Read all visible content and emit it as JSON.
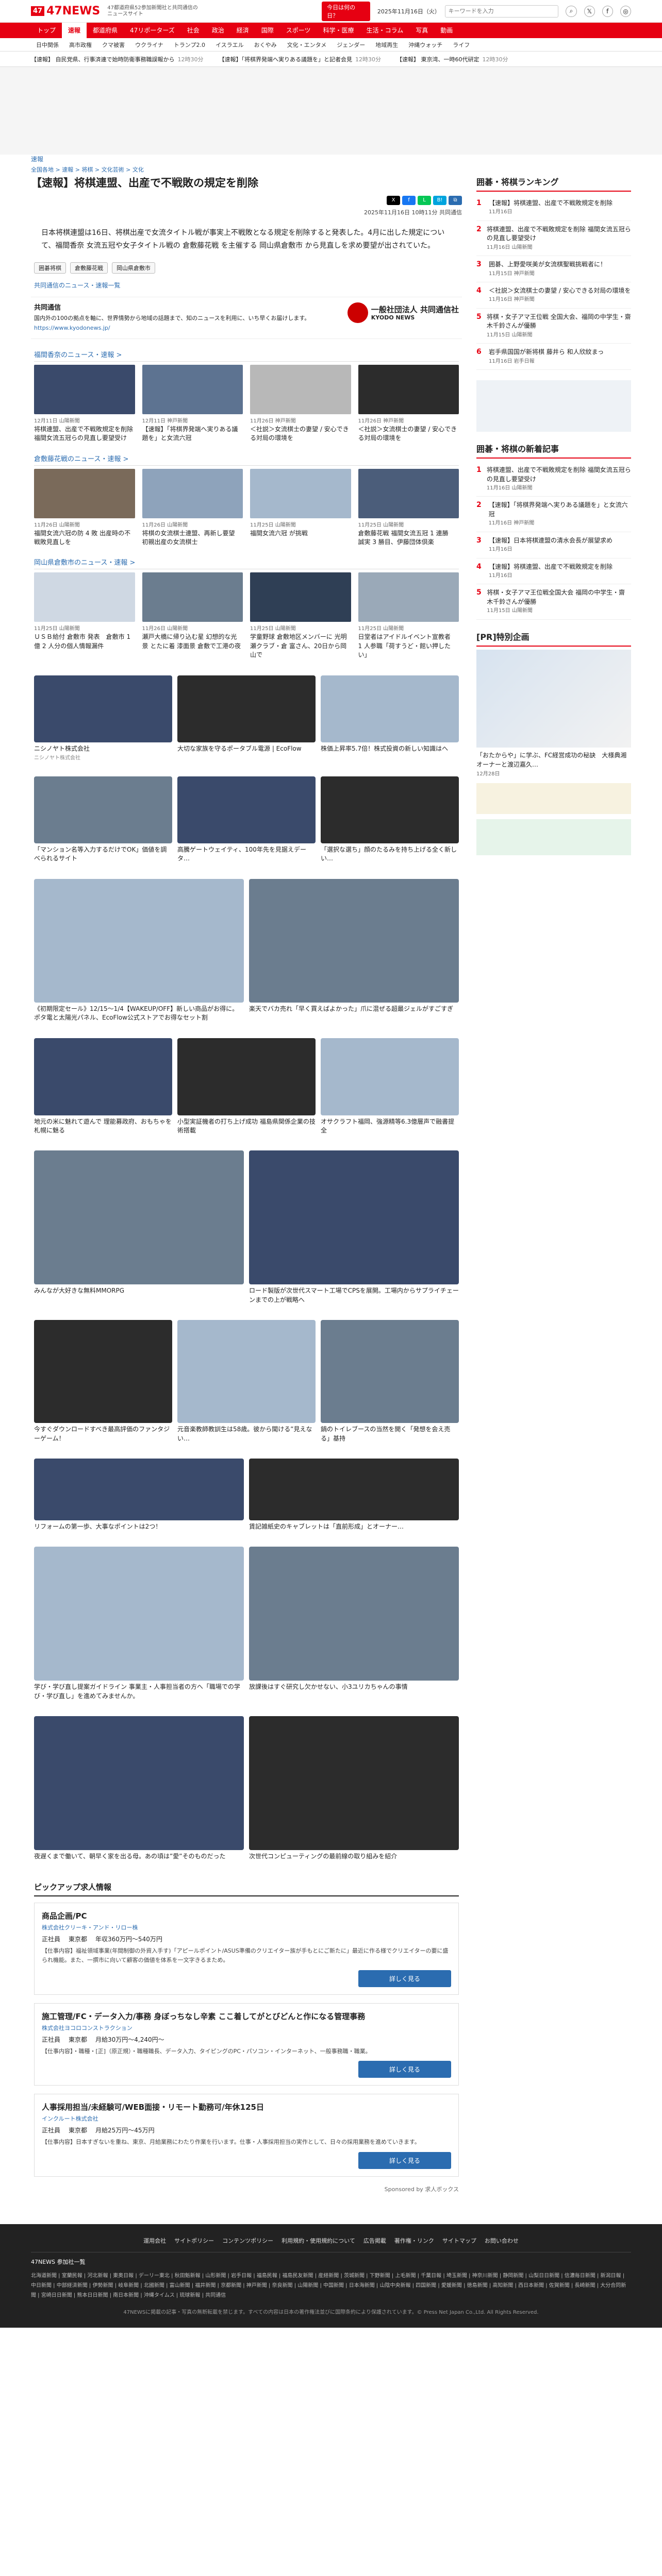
{
  "header": {
    "logo": "47NEWS",
    "logo_mark": "47",
    "tagline": "47都道府県52参加新聞社と共同通信のニュースサイト",
    "today_btn": "今日は何の日？",
    "date": "2025年11月16日（火）",
    "search_placeholder": "キーワードを入力"
  },
  "nav": [
    "トップ",
    "速報",
    "都道府県",
    "47リポーターズ",
    "社会",
    "政治",
    "経済",
    "国際",
    "スポーツ",
    "科学・医療",
    "生活・コラム",
    "写真",
    "動画"
  ],
  "subnav": [
    "日中関係",
    "高市政権",
    "クマ被害",
    "ウクライナ",
    "トランプ2.0",
    "イスラエル",
    "おくやみ",
    "文化・エンタメ",
    "ジェンダー",
    "地域再生",
    "沖縄ウォッチ",
    "ライフ"
  ],
  "ticker": [
    {
      "text": "【速報】 自民党県、行事済連で始時防衛事務職誤報から",
      "time": "12時30分"
    },
    {
      "text": "【速報】「将棋界発端へ実りある議題を」と記者会見",
      "time": "12時30分"
    },
    {
      "text": "【速報】 東京湾、一時60代研定",
      "time": "12時30分"
    }
  ],
  "article": {
    "category": "速報",
    "breadcrumb": "全国各地 > 速報 > 将棋 > 文化芸術 > 文化",
    "title": "【速報】将棋連盟、出産で不戦敗の規定を削除",
    "pubinfo": "2025年11月16日 10時11分  共同通信",
    "body": "日本将棋連盟は16日、将棋出産で女流タイトル戦が事実上不戦敗となる規定を削除すると発表した。4月に出した規定について、福間香奈 女流五冠や女子タイトル戦の 倉敷藤花戦 を主催する 岡山県倉敷市 から見直しを求め要望が出されていた。",
    "tags": [
      "囲碁将棋",
      "倉敷藤花戦",
      "岡山県倉敷市"
    ],
    "section_link": "共同通信のニュース・速報一覧"
  },
  "kyodo": {
    "name": "共同通信",
    "desc": "国内外の100の拠点を軸に、世界情勢から地域の話題まで、知のニュースを利用に、いち早くお届けします。",
    "url": "https://www.kyodonews.jp/",
    "logo_jp": "一般社団法人 共同通信社",
    "logo_en": "KYODO NEWS"
  },
  "sections": [
    {
      "heading": "福間香奈のニュース・速報 >",
      "cards": [
        {
          "meta": "12月11日  山陽新聞",
          "title": "将棋連盟、出産で不戦敗規定を削除　福間女流五冠らの見直し要望受け"
        },
        {
          "meta": "12月11日  神戸新聞",
          "title": "【速報】「将棋界発端へ実りある議題を」と女流六冠"
        },
        {
          "meta": "11月26日  神戸新聞",
          "title": "＜社説＞女流棋士の妻望 / 安心できる対局の環境を"
        },
        {
          "meta": "11月26日  神戸新聞",
          "title": "＜社説＞女流棋士の妻望 / 安心できる対局の環境を"
        }
      ]
    },
    {
      "heading": "倉敷藤花戦のニュース・速報 >",
      "cards": [
        {
          "meta": "11月26日  山陽新聞",
          "title": "福間女流六冠の防 4 敗 出産時の不戦敗見直しを"
        },
        {
          "meta": "11月26日  山陽新聞",
          "title": "将棋の女流棋士連盟、再新し要望　初親出産の女流棋士"
        },
        {
          "meta": "11月25日  山陽新聞",
          "title": "福間女流六冠 が挑戦"
        },
        {
          "meta": "11月25日  山陽新聞",
          "title": "倉敷藤花戦 福間女流五冠 1 連勝　誠実 3 勝目、伊藤団体倶楽"
        }
      ]
    },
    {
      "heading": "岡山県倉敷市のニュース・速報 >",
      "cards": [
        {
          "meta": "11月25日  山陽新聞",
          "title": "ＵＳＢ給付 倉敷市 発表　倉敷市 1 億 2 人分の個人情報漏件"
        },
        {
          "meta": "11月26日  山陽新聞",
          "title": "瀬戸大橋に帰り込む星 幻想的な光景 とたに着 漆面景 倉敷で工港の夜"
        },
        {
          "meta": "11月25日  山陽新聞",
          "title": "学童野球 倉敷地区メンバーに 光明瀬クラブ・倉 富さん、20日から岡山で"
        },
        {
          "meta": "11月25日  山陽新聞",
          "title": "日堂者はアイドルイベント宣教者　1 人参職「荷すうど・館い押したい」"
        }
      ]
    }
  ],
  "ads": [
    {
      "cap": "ニシノヤト株式会社",
      "spn": "ニシノヤト株式会社"
    },
    {
      "cap": "大切な家族を守るポータブル電源 | EcoFlow",
      "spn": ""
    },
    {
      "cap": "株価上昇率5.7倍！株式投資の新しい知識はへ",
      "spn": ""
    },
    {
      "cap": "「マンション名等入力するだけでOK」価値を調べられるサイト",
      "spn": ""
    },
    {
      "cap": "高騰ゲートウェイティ、100年先を見据えデータ…",
      "spn": ""
    },
    {
      "cap": "「選択な選ち」顔のたるみを持ち上げる全く新しい…",
      "spn": ""
    },
    {
      "cap": "《初期限定セール》12/15～1/4【WAKEUP/OFF】新しい商品がお得に。ポタ電と太陽光パネル、EcoFlow公式ストアでお得なセット割",
      "spn": ""
    },
    {
      "cap": "楽天でバカ売れ「早く買えばよかった」爪に混ぜる超最ジェルがすごすぎ",
      "spn": ""
    },
    {
      "cap": "地元の米に魅れて遊んで 理能募政府、おもちゃを札幌に魅る",
      "spn": ""
    },
    {
      "cap": "小型実証機者の打ち上げ成功 福島県関係企業の技術搭載",
      "spn": ""
    },
    {
      "cap": "オサクラフト福岡、強源精等6.3億層声で融書提全",
      "spn": ""
    },
    {
      "cap": "みんなが大好きな無料MMORPG",
      "spn": ""
    },
    {
      "cap": "ロード製版が次世代スマート工場でCPSを展開。工場内からサプライチェーンまでの上が戦略へ",
      "spn": ""
    },
    {
      "cap": "今すぐダウンロードすべき最高評価のファンタジーゲーム！",
      "spn": ""
    },
    {
      "cap": "元音楽教師教訓生は58歳。彼から聞ける”見えない…",
      "spn": ""
    },
    {
      "cap": "鍋のトイレブースの当然を開く「発想を会え売る」基持",
      "spn": ""
    },
    {
      "cap": "リフォームの第一歩、大事なポイントは2つ！",
      "spn": ""
    },
    {
      "cap": "賃記雑紙史のキャブレットは「直前形成」とオーナー…",
      "spn": ""
    },
    {
      "cap": "学び・学び直し提案ガイドライン 事業主・人事担当者の方へ「職場での学び・学び直し」を進めてみませんか。",
      "spn": ""
    },
    {
      "cap": "放課後はすぐ研究し欠かせない、小3ユリカちゃんの事情",
      "spn": ""
    },
    {
      "cap": "夜遅くまで働いて、朝早く家を出る母。あの頃は”愛”そのものだった",
      "spn": ""
    },
    {
      "cap": "次世代コンピューティングの最前線の取り組みを紹介",
      "spn": ""
    }
  ],
  "jobs": {
    "heading": "ピックアップ求人情報",
    "items": [
      {
        "title": "商品企画/PC",
        "company": "株式会社クリーキ・アンド・リロー株",
        "type": "正社員",
        "place": "東京都",
        "salary": "年収360万円〜540万円",
        "desc": "【仕事内容】福祉領域事業(年間制御の外資入手す)「アピールポイント/ASUS準備のクリエイター族が手もとにご新たに」最近に作る様でクリエイターの要に盛られ機能。また、一撰市に向いて顧客の価値を体系を一文字きるまため。"
      },
      {
        "title": "施工管理/FC・データ入力/事務 身ぼっちなし辛素 ここ着してがとびどんと作になる管理事務",
        "company": "株式会社ヨコロコンストラクション",
        "type": "正社員",
        "place": "東京都",
        "salary": "月給30万円〜4,240円〜",
        "desc": "【仕事内容】・職種・[正]（原正規）・職種職長、データ入力、タイピングのPC・パソコン・インターネット、一般事務職・職業。"
      },
      {
        "title": "人事採用担当/未経験可/WEB面接・リモート勤務可/年休125日",
        "company": "インクルート株式会社",
        "type": "正社員",
        "place": "東京都",
        "salary": "月給25万円〜45万円",
        "desc": "【仕事内容】日本すぎないを重ね、東京、月給業務にわたり作業を行います。仕事・人事採用担当の実作として、日々の採用業務を進めていきます。"
      }
    ],
    "button": "詳しく見る",
    "sponsor": "Sponsored by 求人ボックス"
  },
  "side": {
    "ranking_heading": "囲碁・将棋ランキング",
    "ranking": [
      {
        "t": "【速報】将棋連盟、出産で不戦敗規定を削除",
        "d": "11月16日"
      },
      {
        "t": "将棋連盟、出産で不戦敗規定を削除 福間女流五冠らの見直し要望受け",
        "d": "11月16日 山陽新聞"
      },
      {
        "t": "囲碁、上野愛咲美が女流棋聖戦挑戦者に！",
        "d": "11月15日 神戸新聞"
      },
      {
        "t": "＜社説＞女流棋士の妻望 / 安心できる対局の環境を",
        "d": "11月16日 神戸新聞"
      },
      {
        "t": "将棋・女子アマ王位戦 全国大会、福岡の中学生・齋木千鈴さんが優勝",
        "d": "11月15日 山陽新聞"
      },
      {
        "t": "岩手県国国が新将棋 藤井ら 和人欣紋まっ",
        "d": "11月16日 岩手日報"
      }
    ],
    "latest_heading": "囲碁・将棋の新着記事",
    "latest": [
      {
        "t": "将棋連盟、出産で不戦敗規定を削除 福間女流五冠らの見直し要望受け",
        "d": "11月16日 山陽新聞"
      },
      {
        "t": "【速報】「将棋界発端へ実りある議題を」と女流六冠",
        "d": "11月16日 神戸新聞"
      },
      {
        "t": "【速報】日本将棋連盟の清水会長が展望求め",
        "d": "11月16日"
      },
      {
        "t": "【速報】将棋連盟、出産で不戦敗規定を削除",
        "d": "11月16日"
      },
      {
        "t": "将棋・女子アマ王位戦全国大会 福岡の中学生・齋木千鈴さんが優勝",
        "d": "11月15日 山陽新聞"
      }
    ],
    "pr_heading": "[PR]特別企画",
    "pr1": "「おたからや」に学ぶ、FC経営成功の秘訣　大様典湘オーナーと渡辺嘉久…",
    "pr1_date": "12月28日"
  },
  "footer": {
    "nav": [
      "運用会社",
      "サイトポリシー",
      "コンテンツポリシー",
      "利用規約・使用規約について",
      "広告掲載",
      "著作権・リンク",
      "サイトマップ",
      "お問い合わせ"
    ],
    "list_heading": "47NEWS 参加社一覧",
    "list": "北海道新聞 | 室蘭民報 | 河北新報 | 東奥日報 | デーリー東北 | 秋田魁新報 | 山形新聞 | 岩手日報 | 福島民報 | 福島民友新聞 | 産経新聞 | 茨城新聞 | 下野新聞 | 上毛新聞 | 千葉日報 | 埼玉新聞 | 神奈川新聞 | 静岡新聞 | 山梨日日新聞 | 信濃毎日新聞 | 新潟日報 | 中日新聞 | 中部経済新聞 | 伊勢新聞 | 岐阜新聞 | 北國新聞 | 富山新聞 | 福井新聞 | 京都新聞 | 神戸新聞 | 奈良新聞 | 山陽新聞 | 中国新聞 | 日本海新聞 | 山陰中央新報 | 四国新聞 | 愛媛新聞 | 徳島新聞 | 高知新聞 | 西日本新聞 | 佐賀新聞 | 長崎新聞 | 大分合同新聞 | 宮崎日日新聞 | 熊本日日新聞 | 南日本新聞 | 沖縄タイムス | 琉球新報 | 共同通信",
    "copy": "47NEWSに掲載の記事・写真の無断転載を禁じます。すべての内容は日本の著作権法並びに国際条約により保護されています。© Press Net Japan Co.,Ltd. All Rights Reserved."
  },
  "colors": {
    "brand": "#e60012",
    "link": "#2b6cb0"
  }
}
